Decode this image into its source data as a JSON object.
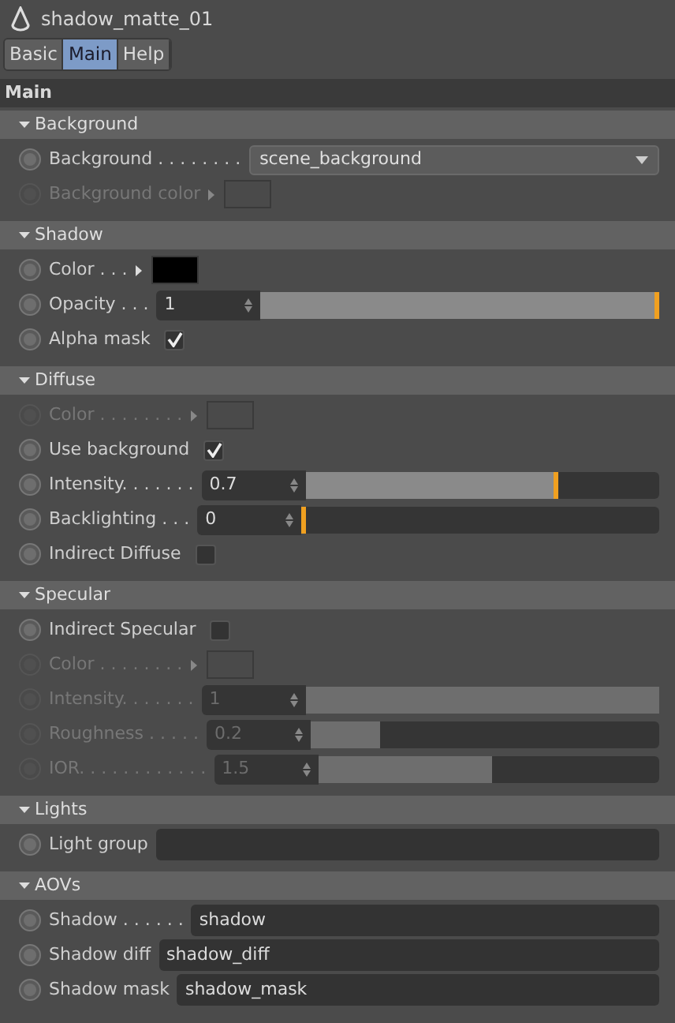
{
  "window": {
    "title": "shadow_matte_01"
  },
  "tabs": [
    {
      "label": "Basic",
      "selected": false
    },
    {
      "label": "Main",
      "selected": true
    },
    {
      "label": "Help",
      "selected": false
    }
  ],
  "panel": {
    "title": "Main"
  },
  "sections": [
    {
      "title": "Background",
      "expanded": true,
      "rows": [
        {
          "kind": "dropdown",
          "label": "Background . . . . . . . .",
          "value": "scene_background",
          "disabled": false
        },
        {
          "kind": "color",
          "label": "Background color",
          "color": "#4a4a4a",
          "disabled": true
        }
      ]
    },
    {
      "title": "Shadow",
      "expanded": true,
      "rows": [
        {
          "kind": "color",
          "label": "Color . . .",
          "color": "#000000",
          "disabled": false
        },
        {
          "kind": "slider",
          "label": "Opacity . . .",
          "value": "1",
          "level": 1,
          "disabled": false
        },
        {
          "kind": "checkbox",
          "label": "Alpha mask",
          "checked": true,
          "disabled": false
        }
      ]
    },
    {
      "title": "Diffuse",
      "expanded": true,
      "rows": [
        {
          "kind": "color",
          "label": "Color . . . . . . . .",
          "color": "#4a4a4a",
          "disabled": true
        },
        {
          "kind": "checkbox",
          "label": "Use background",
          "checked": true,
          "disabled": false
        },
        {
          "kind": "slider",
          "label": "Intensity. . . . . . .",
          "value": "0.7",
          "level": 0.71,
          "disabled": false
        },
        {
          "kind": "slider",
          "label": "Backlighting . . .",
          "value": "0",
          "level": 0,
          "disabled": false
        },
        {
          "kind": "checkbox",
          "label": "Indirect Diffuse",
          "checked": false,
          "disabled": false
        }
      ]
    },
    {
      "title": "Specular",
      "expanded": true,
      "rows": [
        {
          "kind": "checkbox",
          "label": "Indirect Specular",
          "checked": false,
          "disabled": false
        },
        {
          "kind": "color",
          "label": "Color . . . . . . . .",
          "color": "#4a4a4a",
          "disabled": true
        },
        {
          "kind": "slider",
          "label": "Intensity. . . . . . .",
          "value": "1",
          "level": 1,
          "disabled": true
        },
        {
          "kind": "slider",
          "label": "Roughness . . . . .",
          "value": "0.2",
          "level": 0.2,
          "disabled": true
        },
        {
          "kind": "slider",
          "label": "IOR. . . . . . . . . . . .",
          "value": "1.5",
          "level": 0.51,
          "disabled": true
        }
      ]
    },
    {
      "title": "Lights",
      "expanded": true,
      "rows": [
        {
          "kind": "text",
          "label": "Light group",
          "value": "",
          "disabled": false
        }
      ]
    },
    {
      "title": "AOVs",
      "expanded": true,
      "rows": [
        {
          "kind": "text",
          "label": "Shadow . . . . . .",
          "value": "shadow",
          "disabled": false
        },
        {
          "kind": "text",
          "label": "Shadow diff",
          "value": "shadow_diff",
          "disabled": false
        },
        {
          "kind": "text",
          "label": "Shadow mask",
          "value": "shadow_mask",
          "disabled": false
        }
      ]
    }
  ]
}
